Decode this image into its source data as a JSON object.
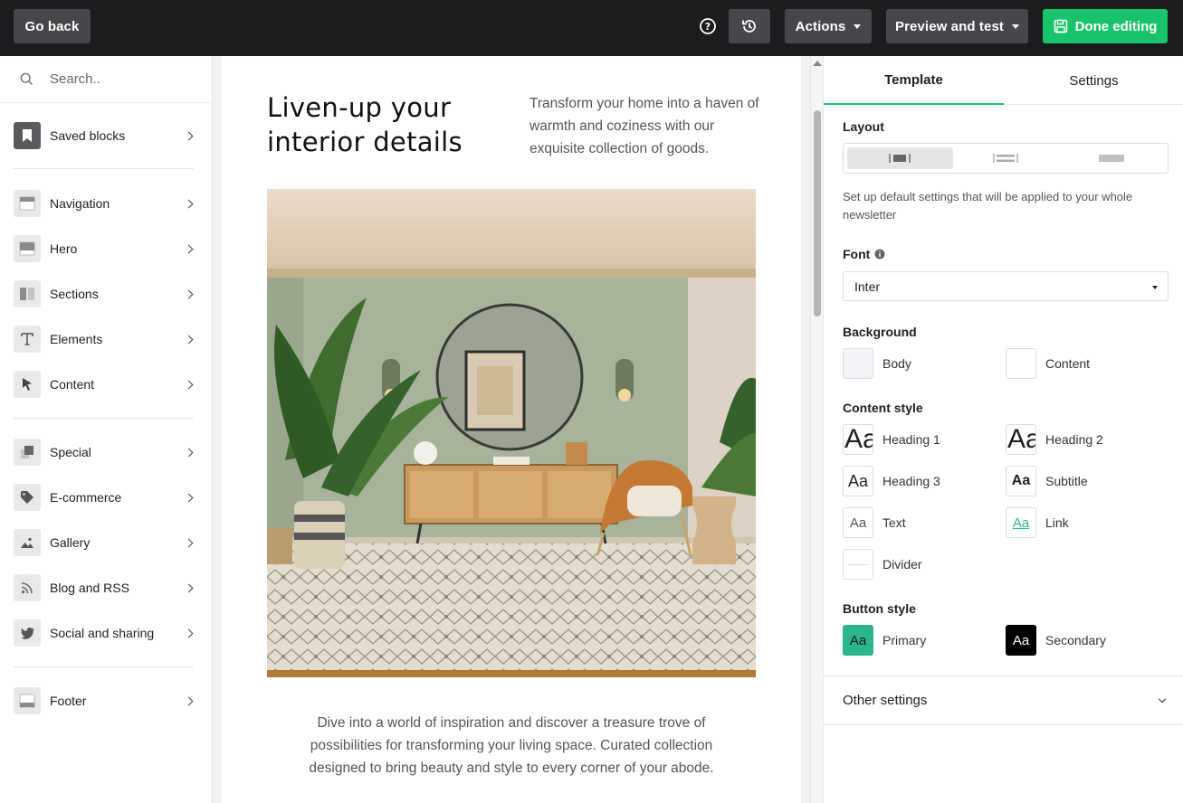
{
  "topbar": {
    "go_back": "Go back",
    "actions": "Actions",
    "preview": "Preview and test",
    "done": "Done editing",
    "accent_color": "#19c36b"
  },
  "sidebar": {
    "search_placeholder": "Search..",
    "items": [
      {
        "label": "Saved blocks",
        "icon": "bookmark-icon"
      },
      {
        "label": "Navigation",
        "icon": "navigation-block-icon"
      },
      {
        "label": "Hero",
        "icon": "hero-block-icon"
      },
      {
        "label": "Sections",
        "icon": "sections-block-icon"
      },
      {
        "label": "Elements",
        "icon": "text-icon"
      },
      {
        "label": "Content",
        "icon": "cursor-icon"
      },
      {
        "label": "Special",
        "icon": "special-icon"
      },
      {
        "label": "E-commerce",
        "icon": "tag-icon"
      },
      {
        "label": "Gallery",
        "icon": "image-icon"
      },
      {
        "label": "Blog and RSS",
        "icon": "rss-icon"
      },
      {
        "label": "Social and sharing",
        "icon": "twitter-icon"
      },
      {
        "label": "Footer",
        "icon": "footer-block-icon"
      }
    ]
  },
  "email": {
    "headline": "Liven-up your interior details",
    "intro": "Transform your home into a haven of warmth and coziness with our exquisite collection of goods.",
    "body": "Dive into a world of inspiration and discover a treasure trove of possibilities for transforming your living space. Curated collection designed to bring beauty and style to every corner of your abode."
  },
  "panel": {
    "tabs": [
      "Template",
      "Settings"
    ],
    "active_tab": "Template",
    "layout_title": "Layout",
    "layout_description": "Set up default settings that will be applied to your whole newsletter",
    "font_title": "Font",
    "font_value": "Inter",
    "background_title": "Background",
    "background": [
      {
        "label": "Body",
        "color": "#f2f4f7"
      },
      {
        "label": "Content",
        "color": "#ffffff"
      }
    ],
    "content_style_title": "Content style",
    "content_styles": [
      {
        "label": "Heading 1",
        "sample": "Aa"
      },
      {
        "label": "Heading 2",
        "sample": "Aa"
      },
      {
        "label": "Heading 3",
        "sample": "Aa"
      },
      {
        "label": "Subtitle",
        "sample": "Aa"
      },
      {
        "label": "Text",
        "sample": "Aa"
      },
      {
        "label": "Link",
        "sample": "Aa"
      },
      {
        "label": "Divider",
        "sample": ""
      }
    ],
    "button_style_title": "Button style",
    "button_styles": [
      {
        "label": "Primary",
        "sample": "Aa",
        "color": "#2bb58a"
      },
      {
        "label": "Secondary",
        "sample": "Aa",
        "color": "#000000"
      }
    ],
    "other_settings": "Other settings"
  }
}
